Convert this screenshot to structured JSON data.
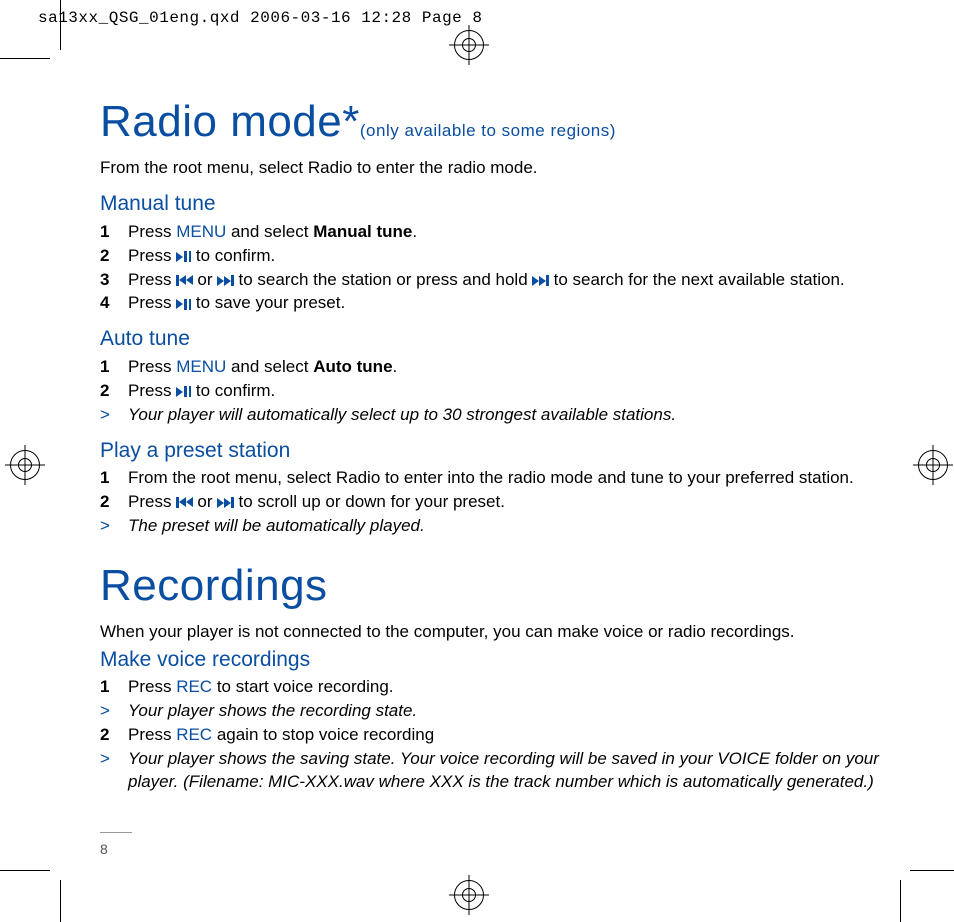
{
  "slug": "sa13xx_QSG_01eng.qxd  2006-03-16  12:28  Page 8",
  "h1a": {
    "title": "Radio mode*",
    "sub": "(only available to some regions)"
  },
  "intro1": "From the root menu, select Radio to enter the radio mode.",
  "manual": {
    "heading": "Manual tune",
    "s1_a": "Press ",
    "s1_menu": "MENU",
    "s1_b": " and select ",
    "s1_bold": "Manual tune",
    "s1_c": ".",
    "s2_a": "Press ",
    "s2_b": " to confirm.",
    "s3_a": "Press ",
    "s3_b": " or ",
    "s3_c": " to search the station or press and hold ",
    "s3_d": " to search for the next available station.",
    "s4_a": "Press ",
    "s4_b": " to save your preset."
  },
  "auto": {
    "heading": "Auto tune",
    "s1_a": "Press ",
    "s1_menu": "MENU",
    "s1_b": " and select ",
    "s1_bold": "Auto tune",
    "s1_c": ".",
    "s2_a": "Press ",
    "s2_b": " to confirm.",
    "note": "Your player will automatically select up to 30 strongest available stations."
  },
  "preset": {
    "heading": "Play a preset station",
    "s1": "From the root menu, select Radio to enter into the radio mode and tune to your preferred station.",
    "s2_a": "Press ",
    "s2_b": " or ",
    "s2_c": " to scroll up or down for your preset.",
    "note": "The preset will be automatically played."
  },
  "h1b": "Recordings",
  "intro2": "When your player is not connected to the computer, you can make voice or radio recordings.",
  "voice": {
    "heading": "Make voice recordings",
    "s1_a": "Press ",
    "s1_rec": "REC",
    "s1_b": " to start voice recording.",
    "note1": "Your player shows the recording state.",
    "s2_a": "Press ",
    "s2_rec": "REC",
    "s2_b": " again to stop voice recording",
    "note2": "Your player shows the saving state. Your voice recording will be saved in your VOICE folder on your player. (Filename: MIC-XXX.wav where XXX is the track number which is automatically generated.)"
  },
  "pagenum": "8"
}
